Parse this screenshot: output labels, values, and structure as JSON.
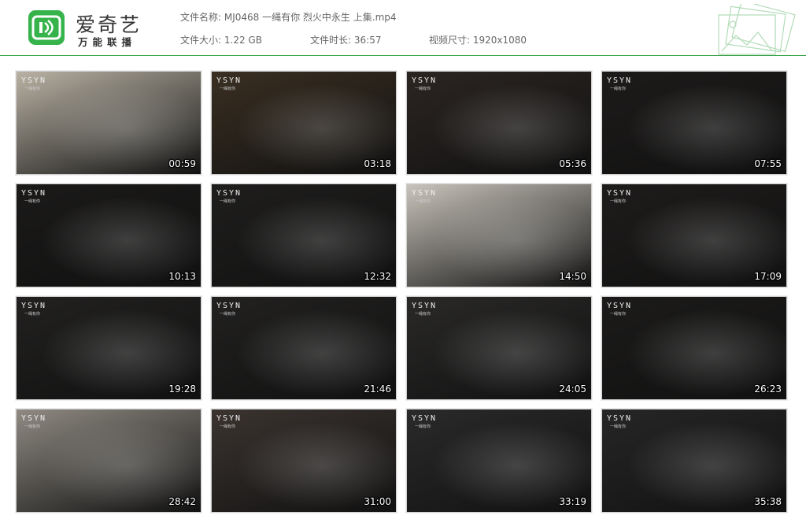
{
  "brand": {
    "name": "爱奇艺",
    "tagline": "万能联播",
    "accent": "#36b34a"
  },
  "file": {
    "name_label": "文件名称:",
    "name_value": "MJ0468 一绳有你 烈火中永生 上集.mp4",
    "size_label": "文件大小:",
    "size_value": "1.22 GB",
    "duration_label": "文件时长:",
    "duration_value": "36:57",
    "resolution_label": "视频尺寸:",
    "resolution_value": "1920x1080"
  },
  "watermark": {
    "logo": "YSYN",
    "sub": "一绳有你"
  },
  "thumbnails": [
    {
      "time": "00:59",
      "bg": "#b9b2a4"
    },
    {
      "time": "03:18",
      "bg": "#3a2f22"
    },
    {
      "time": "05:36",
      "bg": "#2b2522"
    },
    {
      "time": "07:55",
      "bg": "#1d1b1a"
    },
    {
      "time": "10:13",
      "bg": "#1b1a19"
    },
    {
      "time": "12:32",
      "bg": "#1f1e1d"
    },
    {
      "time": "14:50",
      "bg": "#c9c4bb"
    },
    {
      "time": "17:09",
      "bg": "#1e1c1b"
    },
    {
      "time": "19:28",
      "bg": "#222120"
    },
    {
      "time": "21:46",
      "bg": "#222120"
    },
    {
      "time": "24:05",
      "bg": "#2a2928"
    },
    {
      "time": "26:23",
      "bg": "#1c1b1a"
    },
    {
      "time": "28:42",
      "bg": "#8f8a82"
    },
    {
      "time": "31:00",
      "bg": "#3b3430"
    },
    {
      "time": "33:19",
      "bg": "#2a2a2a"
    },
    {
      "time": "35:38",
      "bg": "#262626"
    }
  ]
}
